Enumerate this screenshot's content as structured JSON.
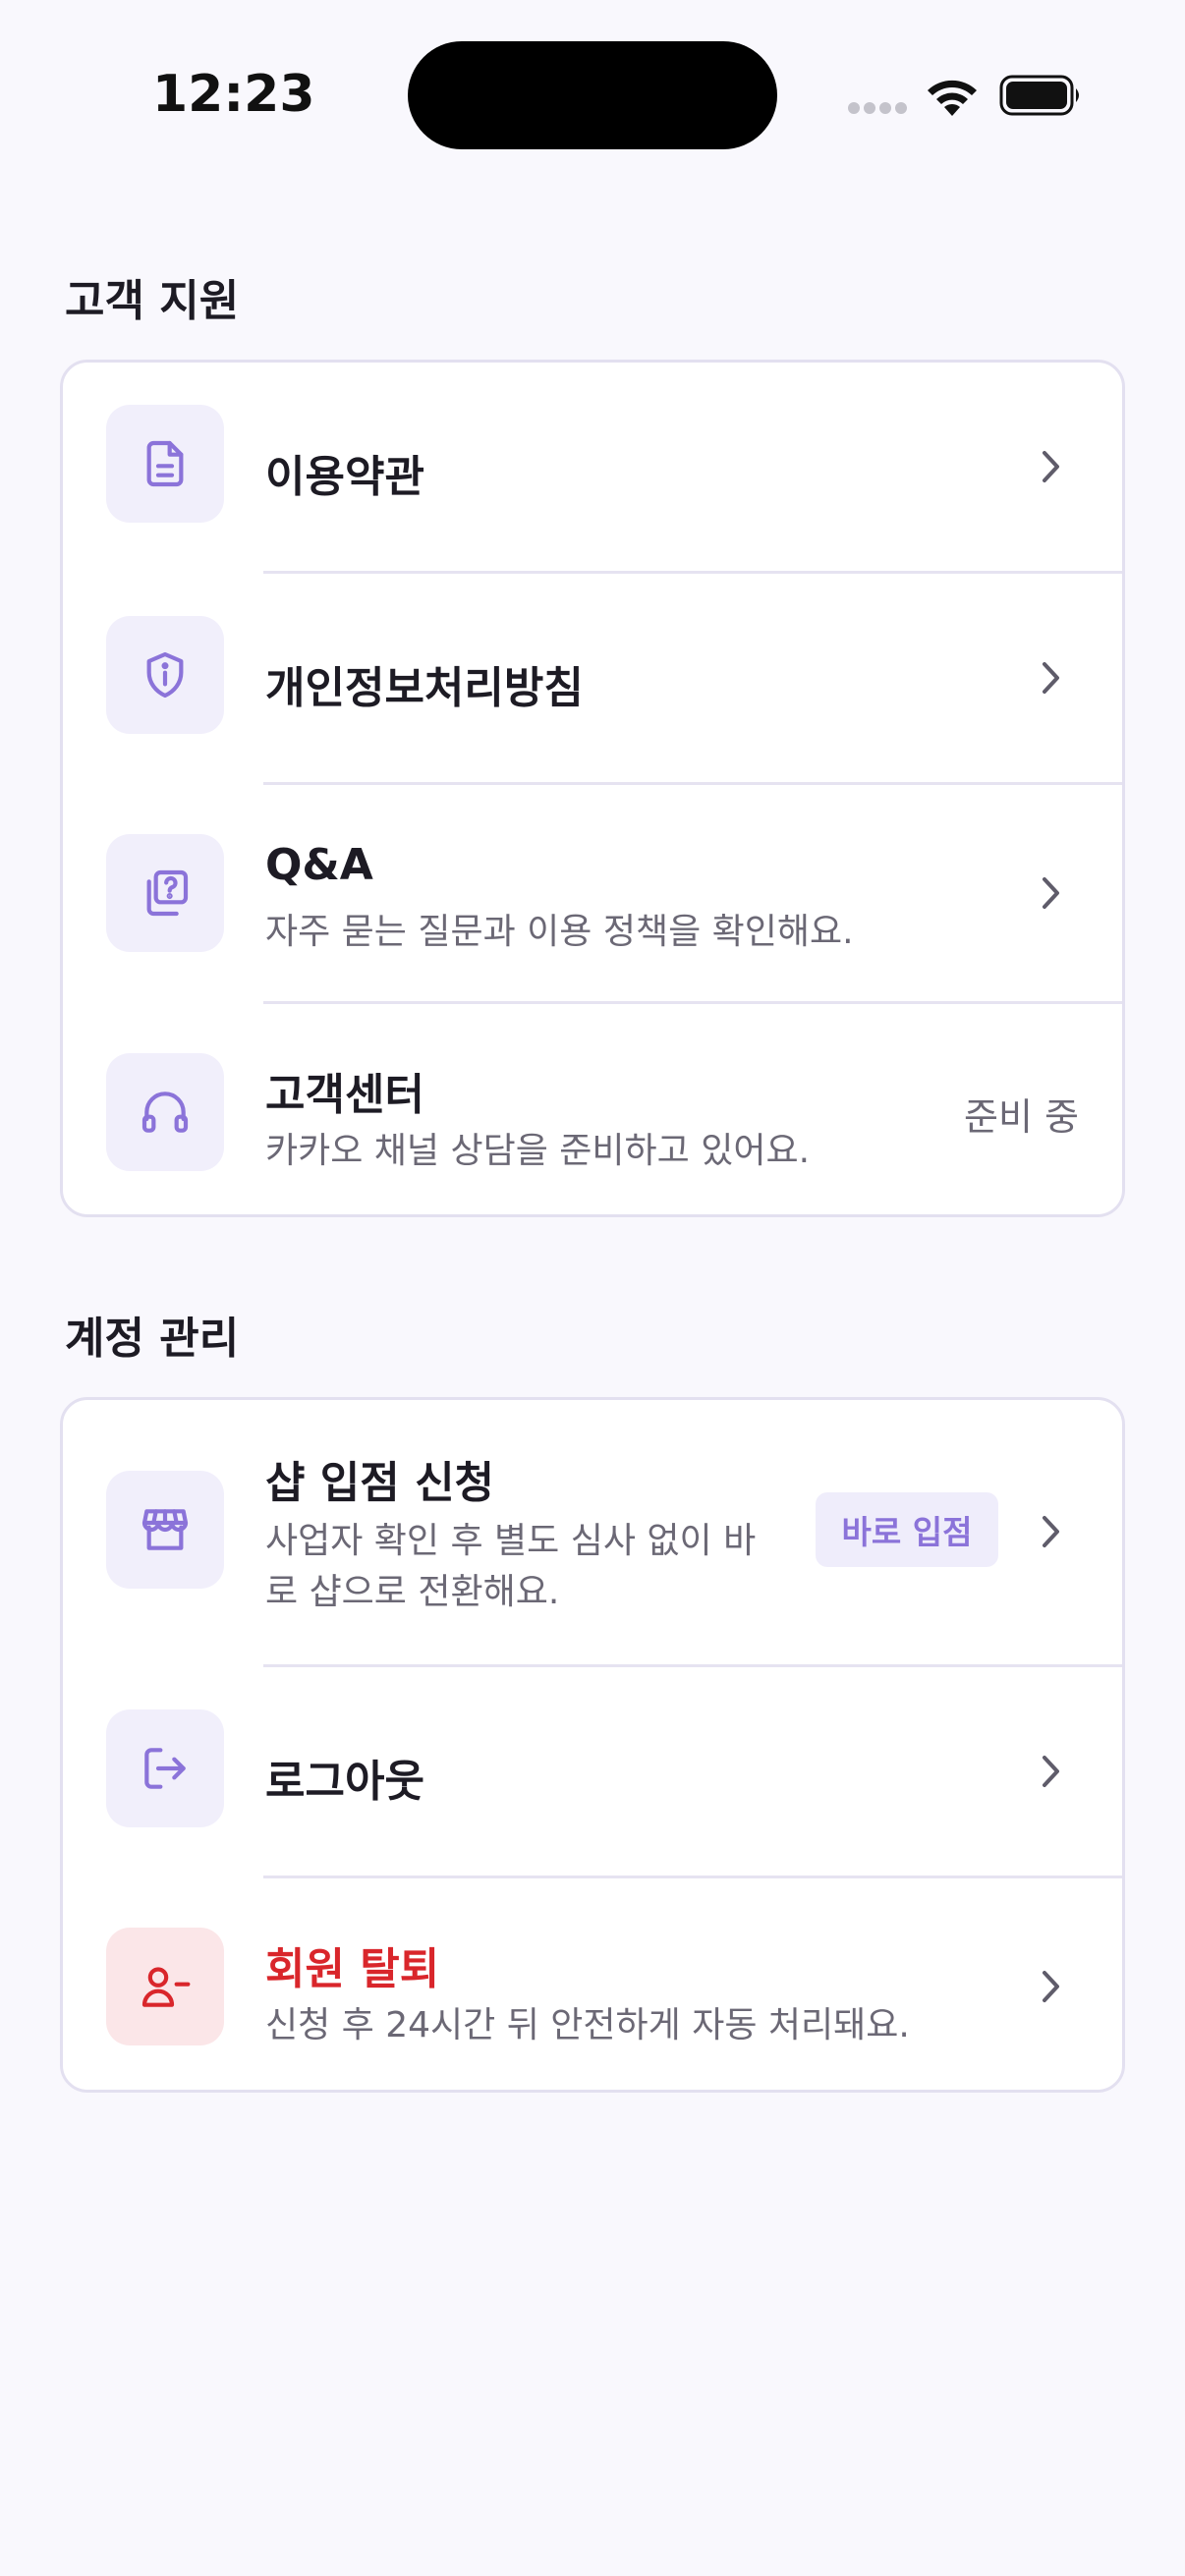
{
  "status_bar": {
    "time": "12:23"
  },
  "sections": {
    "support": {
      "title": "고객 지원",
      "items": [
        {
          "title": "이용약관",
          "icon": "document-icon"
        },
        {
          "title": "개인정보처리방침",
          "icon": "shield-info-icon"
        },
        {
          "title": "Q&A",
          "subtitle": "자주 묻는 질문과 이용 정책을 확인해요.",
          "icon": "question-copy-icon"
        },
        {
          "title": "고객센터",
          "subtitle": "카카오 채널 상담을 준비하고 있어요.",
          "status": "준비 중",
          "icon": "headset-icon"
        }
      ]
    },
    "account": {
      "title": "계정 관리",
      "items": [
        {
          "title": "샵 입점 신청",
          "subtitle_line1": "사업자 확인 후 별도 심사 없이 바",
          "subtitle_line2": "로 샵으로 전환해요.",
          "badge": "바로 입점",
          "icon": "store-icon"
        },
        {
          "title": "로그아웃",
          "icon": "logout-icon"
        },
        {
          "title": "회원 탈퇴",
          "subtitle": "신청 후 24시간 뒤 안전하게 자동 처리돼요.",
          "icon": "user-remove-icon"
        }
      ]
    }
  },
  "colors": {
    "accent": "#8b73d9",
    "danger": "#d9262b",
    "background": "#f9f8fd"
  }
}
